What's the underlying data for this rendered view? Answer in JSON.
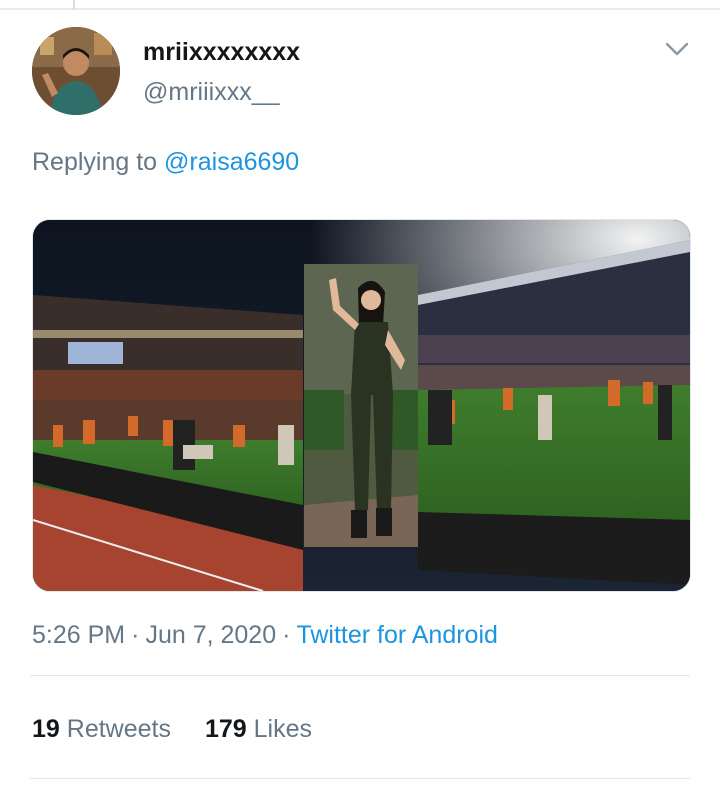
{
  "tweet": {
    "display_name": "mriixxxxxxxx",
    "handle": "@mriiixxx__",
    "replying_prefix": "Replying to ",
    "replying_to": "@raisa6690",
    "time": "5:26 PM",
    "date": "Jun 7, 2020",
    "separator": "·",
    "source": "Twitter for Android",
    "retweets_count": "19",
    "retweets_label": "Retweets",
    "likes_count": "179",
    "likes_label": "Likes"
  },
  "icons": {
    "menu": "chevron-down-icon",
    "avatar": "avatar"
  },
  "colors": {
    "link": "#1b95e0",
    "secondary_text": "#657786",
    "primary_text": "#14171a",
    "divider": "#e1e8ed"
  }
}
